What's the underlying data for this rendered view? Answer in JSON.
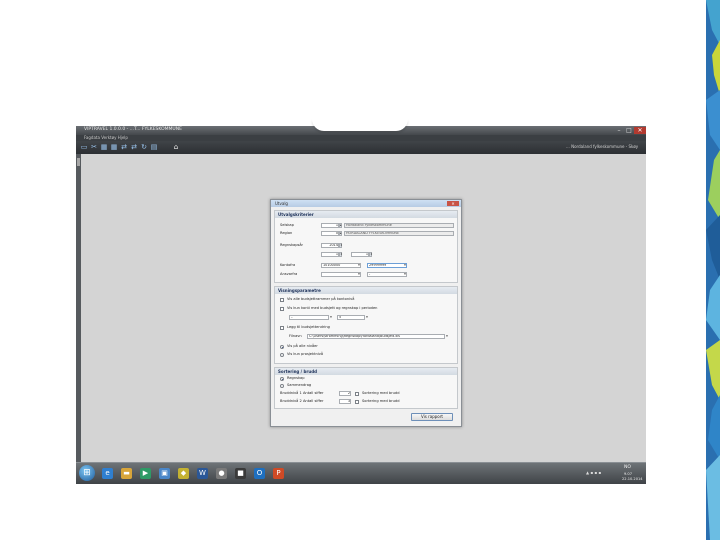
{
  "window": {
    "title": "VIPTRAVEL 1.0.0.0 - ...T... FYLKESKOMMUNE",
    "menu": "Fagdata    Verktøy    Hjelp",
    "user": "... Nordaland fylkeskommune - Skøy",
    "controls": {
      "minimize": "–",
      "maximize": "□",
      "close": "✕"
    }
  },
  "toolbar_icons": [
    "document-icon",
    "tools-icon",
    "grid-icon",
    "grid-icon",
    "swap-icon",
    "swap-icon",
    "refresh-icon",
    "chart-icon",
    "home-icon"
  ],
  "dialog": {
    "title": "Utvalg",
    "close": "✕",
    "sections": {
      "utvalg": {
        "heading": "Utvalgskriterier",
        "rows": [
          {
            "label": "Selskap",
            "code": "1",
            "name": "Hordaland Fylkeskommune"
          },
          {
            "label": "Region",
            "code": "0",
            "name": "HORDALAND FYLKESKOMMUNE"
          }
        ],
        "regnskapsaar_label": "Regnskapsår",
        "regnskapsaar_value": "2014",
        "periode_from": "1",
        "periode_to": "1",
        "konto_label": "Kontofra",
        "konto_from": "10100000",
        "konto_to": "29999999",
        "ansvar_label": "Ansvarfra",
        "ansvar_dash": "-"
      },
      "visning": {
        "heading": "Visningsparametre",
        "options": [
          {
            "label": "Vis alle budsjettrammer på kontonivå",
            "checked": false
          },
          {
            "label": "Vis kun konti med budsjett og regnskap i perioden",
            "checked": false
          }
        ],
        "range_dash": "–",
        "range_value": "5",
        "excel_option": "Legg til budsjettendring",
        "filename_label": "Filnavn",
        "filename_value": "C:\\Users\\stromming\\Regnskap\\Hordaland\\Budsjett.xls",
        "radios": [
          {
            "label": "Vis på alle nivåer",
            "on": true
          },
          {
            "label": "Vis kun prosjektnivå",
            "on": false
          }
        ]
      },
      "sortering": {
        "heading": "Sortering / brudd",
        "radios": [
          {
            "label": "Regnskap",
            "on": true
          },
          {
            "label": "Sammendrag",
            "on": false
          }
        ],
        "rows": [
          {
            "label": "Bruddnivå 1 Antall siffer",
            "value": "2",
            "check_label": "Sortering med brudd"
          },
          {
            "label": "Bruddnivå 2 Antall siffer",
            "value": "3",
            "check_label": "Sortering med brudd"
          }
        ]
      }
    },
    "ok_label": "Vis rapport"
  },
  "taskbar": {
    "start": "⊞",
    "apps": [
      {
        "name": "ie-icon",
        "glyph": "e",
        "color": "#2f7fd0"
      },
      {
        "name": "folder-icon",
        "glyph": "▬",
        "color": "#d8a53a"
      },
      {
        "name": "media-icon",
        "glyph": "▶",
        "color": "#2e9a66"
      },
      {
        "name": "app-icon",
        "glyph": "▣",
        "color": "#4a86c8"
      },
      {
        "name": "app-icon",
        "glyph": "◆",
        "color": "#c4b232"
      },
      {
        "name": "word-icon",
        "glyph": "W",
        "color": "#2b5797"
      },
      {
        "name": "app-icon",
        "glyph": "●",
        "color": "#7a7a7a"
      },
      {
        "name": "app-icon",
        "glyph": "■",
        "color": "#3a3a3a"
      },
      {
        "name": "outlook-icon",
        "glyph": "O",
        "color": "#1e6fbf"
      },
      {
        "name": "powerpoint-icon",
        "glyph": "P",
        "color": "#cf4a26"
      }
    ],
    "tray": {
      "lang": "NO",
      "time": "9.07",
      "date": "22.10.2014",
      "icons": "▲ ▪ ▪ ▪"
    }
  },
  "colors": {
    "accent": "#1b2f58",
    "taskbar": "#4a4f53",
    "desktop": "#d4d4d4"
  }
}
